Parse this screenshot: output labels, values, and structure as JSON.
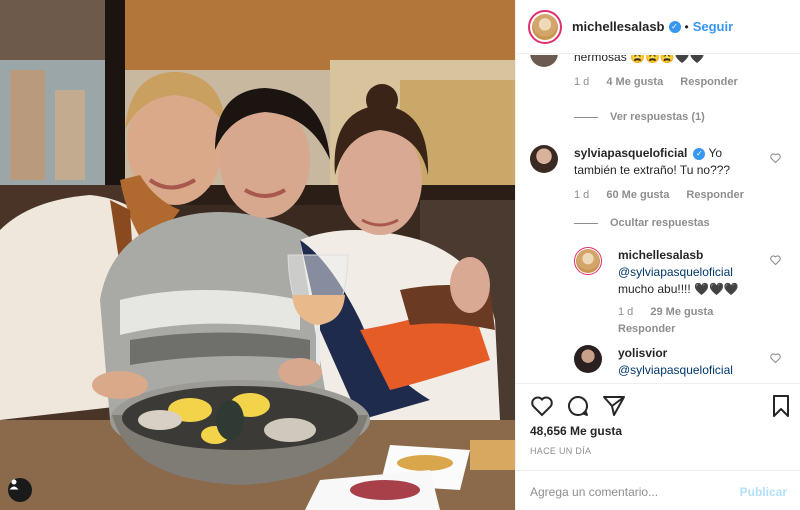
{
  "post": {
    "author": "michellesalasb",
    "follow_label": "Seguir",
    "likes_total": "48,656 Me gusta",
    "timestamp": "HACE UN DÍA"
  },
  "comments": [
    {
      "id": "c0",
      "text": "hermosas 😩😩😩🖤🖤",
      "age": "1 d",
      "likes": "4 Me gusta",
      "reply_label": "Responder",
      "toggle": "Ver respuestas (1)"
    },
    {
      "id": "c1",
      "user": "sylviapasqueloficial",
      "text": "Yo también te extraño! Tu no???",
      "age": "1 d",
      "likes": "60 Me gusta",
      "reply_label": "Responder",
      "toggle": "Ocultar respuestas"
    },
    {
      "id": "c2",
      "user": "michellesalasb",
      "mention": "@sylviapasqueloficial",
      "text": "mucho abu!!!! 🖤🖤🖤",
      "age": "1 d",
      "likes": "29 Me gusta",
      "reply_label": "Responder"
    },
    {
      "id": "c3",
      "user": "yolisvior",
      "mention": "@sylviapasqueloficial"
    }
  ],
  "composer": {
    "placeholder": "Agrega un comentario...",
    "publish_label": "Publicar"
  },
  "colors": {
    "accent": "#3897f0",
    "publish_disabled": "#b2dffc",
    "muted": "#8e8e8e"
  }
}
